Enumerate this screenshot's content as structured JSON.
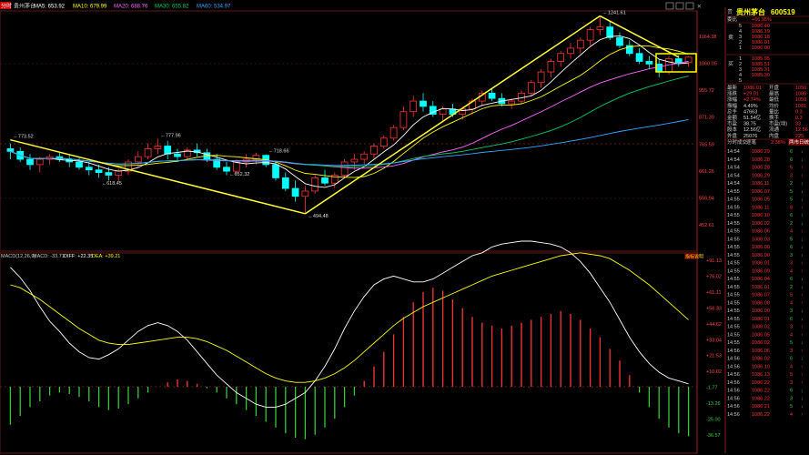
{
  "window": {
    "title_tag": "分时",
    "ma_legend": {
      "stock": "贵州茅台",
      "ma5": "MA5: 653.92",
      "ma10": "MA10: 679.99",
      "ma20": "MA20: 688.76",
      "ma30": "MA30: 655.82",
      "ma60": "MA60: 534.97"
    },
    "macd_legend": {
      "params": "MACD(12,26,9)",
      "macd": "MACD: -33.71",
      "diff": "DIFF: +22.35",
      "dea": "DEA: +39.21"
    },
    "indicator_button": "指标说明",
    "price_axis": [
      "1164.38",
      "1060.05",
      "955.72",
      "871.39",
      "765.59",
      "661.26",
      "556.94",
      "452.61"
    ],
    "macd_axis": [
      "+91.13",
      "+76.02",
      "+61.11",
      "+56.33",
      "+44.62",
      "+33.04",
      "+21.53",
      "+10.02",
      "-1.77",
      "-13.26",
      "-25.00",
      "-36.57"
    ],
    "macd_axis_colors": [
      "red",
      "red",
      "red",
      "red",
      "red",
      "red",
      "red",
      "red",
      "green",
      "green",
      "green",
      "green"
    ],
    "annotations": {
      "peak": "1241.61",
      "left_high": "773.52",
      "low1": "618.45",
      "mid_high": "777.96",
      "low2": "652.32",
      "mid_high2": "718.66",
      "bottom": "494.48"
    }
  },
  "quote_panel": {
    "header_glyph": "贵",
    "title": "贵州茅台",
    "code": "600519",
    "weibi_label": "委比",
    "weibi_value": "+66.95%",
    "sell_label": "卖",
    "buy_label": "买",
    "sell_orders": [
      {
        "n": "5",
        "price": "1086.40"
      },
      {
        "n": "4",
        "price": "1086.19"
      },
      {
        "n": "3",
        "price": "1086.18"
      },
      {
        "n": "2",
        "price": "1086.01"
      },
      {
        "n": "1",
        "price": "1086.00"
      }
    ],
    "buy_orders": [
      {
        "n": "1",
        "price": "1085.95"
      },
      {
        "n": "2",
        "price": "1085.51"
      },
      {
        "n": "3",
        "price": "1085.31"
      },
      {
        "n": "4",
        "price": "1085.30"
      },
      {
        "n": "5",
        "price": ""
      }
    ],
    "stats": [
      {
        "label": "最新",
        "value": "1086.01",
        "label2": "开盘",
        "value2": "1050"
      },
      {
        "label": "涨跌",
        "value": "+29.01",
        "label2": "最高",
        "value2": "1086"
      },
      {
        "label": "涨幅",
        "value": "+2.74%",
        "label2": "最低",
        "value2": "1050"
      },
      {
        "label": "振幅",
        "value": "4.49%",
        "label2": "均价",
        "value2": "1081"
      },
      {
        "label": "总手",
        "value": "47663",
        "label2": "量比",
        "value2": "0.3"
      },
      {
        "label": "金额",
        "value": "51.54亿",
        "label2": "换手",
        "value2": "0.3"
      },
      {
        "label": "市盈",
        "value": "38.75",
        "label2": "市盈(动)",
        "value2": "33"
      },
      {
        "label": "股本",
        "value": "12.56亿",
        "label2": "流通",
        "value2": "12.56"
      },
      {
        "label": "外盘",
        "value": "25076",
        "label2": "内盘",
        "value2": "225"
      }
    ],
    "trades_header": {
      "left": "分时成交",
      "right": "逐笔",
      "pct": "2.38%",
      "btn": "两市日统"
    },
    "trades": [
      {
        "t": "14:54",
        "p": "1086.29",
        "v": "6",
        "c": "green"
      },
      {
        "t": "14:54",
        "p": "1086.28",
        "v": "6",
        "c": "green"
      },
      {
        "t": "14:54",
        "p": "1086.28",
        "v": "5",
        "c": "red"
      },
      {
        "t": "14:54",
        "p": "1086.29",
        "v": "3",
        "c": "red"
      },
      {
        "t": "14:54",
        "p": "1086.11",
        "v": "2",
        "c": "green"
      },
      {
        "t": "14:55",
        "p": "1086.07",
        "v": "5",
        "c": "green"
      },
      {
        "t": "14:55",
        "p": "1086.05",
        "v": "5",
        "c": "green"
      },
      {
        "t": "14:55",
        "p": "1086.11",
        "v": "8",
        "c": "red"
      },
      {
        "t": "14:55",
        "p": "1086.10",
        "v": "6",
        "c": "green"
      },
      {
        "t": "14:55",
        "p": "1086.02",
        "v": "2",
        "c": "green"
      },
      {
        "t": "14:55",
        "p": "1086.06",
        "v": "4",
        "c": "red"
      },
      {
        "t": "14:55",
        "p": "1086.03",
        "v": "5",
        "c": "green"
      },
      {
        "t": "14:55",
        "p": "1086.00",
        "v": "6",
        "c": "green"
      },
      {
        "t": "14:55",
        "p": "1086.00",
        "v": "3",
        "c": "green"
      },
      {
        "t": "14:55",
        "p": "1086.01",
        "v": "3",
        "c": "red"
      },
      {
        "t": "14:55",
        "p": "1086.09",
        "v": "4",
        "c": "red"
      },
      {
        "t": "14:55",
        "p": "1086.04",
        "v": "6",
        "c": "green"
      },
      {
        "t": "14:55",
        "p": "1086.01",
        "v": "2",
        "c": "green"
      },
      {
        "t": "14:55",
        "p": "1086.07",
        "v": "5",
        "c": "red"
      },
      {
        "t": "14:55",
        "p": "1086.08",
        "v": "4",
        "c": "red"
      },
      {
        "t": "14:55",
        "p": "1086.00",
        "v": "3",
        "c": "green"
      },
      {
        "t": "14:55",
        "p": "1086.01",
        "v": "6",
        "c": "green"
      },
      {
        "t": "14:55",
        "p": "1086.02",
        "v": "3",
        "c": "red"
      },
      {
        "t": "14:55",
        "p": "1086.05",
        "v": "4",
        "c": "red"
      },
      {
        "t": "14:55",
        "p": "1086.02",
        "v": "5",
        "c": "green"
      },
      {
        "t": "14:56",
        "p": "1086.06",
        "v": "3",
        "c": "red"
      },
      {
        "t": "14:56",
        "p": "1086.02",
        "v": "6",
        "c": "green"
      },
      {
        "t": "14:56",
        "p": "1086.10",
        "v": "4",
        "c": "red"
      },
      {
        "t": "14:56",
        "p": "1086.13",
        "v": "5",
        "c": "red"
      },
      {
        "t": "14:56",
        "p": "1086.22",
        "v": "3",
        "c": "red"
      },
      {
        "t": "14:56",
        "p": "1086.22",
        "v": "6",
        "c": "green"
      },
      {
        "t": "14:56",
        "p": "1086.22",
        "v": "3",
        "c": "green"
      },
      {
        "t": "14:56",
        "p": "1086.21",
        "v": "5",
        "c": "green"
      },
      {
        "t": "14:56",
        "p": "1086.22",
        "v": "4",
        "c": "red"
      }
    ]
  },
  "chart_data": {
    "type": "candlestick",
    "ma_colors": {
      "ma5": "#ffffff",
      "ma10": "#ffff00",
      "ma20": "#ff66ff",
      "ma30": "#00cc66",
      "ma60": "#33aaff"
    },
    "up_color": "#ff3333",
    "down_color": "#00ffff",
    "ylim": [
      452.61,
      1164.38
    ],
    "candles": [
      [
        740,
        760,
        700,
        730
      ],
      [
        730,
        745,
        690,
        700
      ],
      [
        700,
        720,
        660,
        680
      ],
      [
        680,
        710,
        650,
        700
      ],
      [
        700,
        720,
        680,
        710
      ],
      [
        710,
        725,
        690,
        700
      ],
      [
        700,
        715,
        670,
        690
      ],
      [
        690,
        705,
        660,
        670
      ],
      [
        670,
        690,
        640,
        660
      ],
      [
        660,
        680,
        630,
        650
      ],
      [
        650,
        670,
        620,
        640
      ],
      [
        640,
        665,
        615,
        655
      ],
      [
        655,
        700,
        640,
        690
      ],
      [
        690,
        730,
        670,
        710
      ],
      [
        710,
        760,
        700,
        740
      ],
      [
        740,
        778,
        720,
        750
      ],
      [
        750,
        770,
        700,
        720
      ],
      [
        720,
        740,
        690,
        710
      ],
      [
        710,
        745,
        695,
        735
      ],
      [
        735,
        760,
        710,
        725
      ],
      [
        725,
        740,
        690,
        700
      ],
      [
        700,
        720,
        660,
        670
      ],
      [
        670,
        690,
        640,
        655
      ],
      [
        655,
        700,
        645,
        690
      ],
      [
        690,
        720,
        670,
        700
      ],
      [
        700,
        725,
        680,
        715
      ],
      [
        715,
        719,
        670,
        680
      ],
      [
        680,
        690,
        620,
        630
      ],
      [
        630,
        650,
        580,
        590
      ],
      [
        590,
        620,
        540,
        560
      ],
      [
        560,
        600,
        495,
        580
      ],
      [
        580,
        640,
        570,
        630
      ],
      [
        630,
        660,
        600,
        610
      ],
      [
        610,
        650,
        590,
        640
      ],
      [
        640,
        700,
        630,
        690
      ],
      [
        690,
        720,
        660,
        700
      ],
      [
        700,
        730,
        680,
        720
      ],
      [
        720,
        760,
        700,
        750
      ],
      [
        750,
        790,
        740,
        780
      ],
      [
        780,
        830,
        770,
        820
      ],
      [
        820,
        900,
        810,
        880
      ],
      [
        880,
        940,
        860,
        920
      ],
      [
        920,
        950,
        880,
        900
      ],
      [
        900,
        920,
        860,
        870
      ],
      [
        870,
        900,
        840,
        890
      ],
      [
        890,
        910,
        860,
        870
      ],
      [
        870,
        900,
        850,
        890
      ],
      [
        890,
        930,
        870,
        920
      ],
      [
        920,
        960,
        900,
        950
      ],
      [
        950,
        970,
        920,
        930
      ],
      [
        930,
        950,
        900,
        910
      ],
      [
        910,
        930,
        890,
        920
      ],
      [
        920,
        960,
        910,
        950
      ],
      [
        950,
        1000,
        940,
        990
      ],
      [
        990,
        1040,
        970,
        1030
      ],
      [
        1030,
        1080,
        1010,
        1070
      ],
      [
        1070,
        1110,
        1050,
        1100
      ],
      [
        1100,
        1140,
        1080,
        1120
      ],
      [
        1120,
        1160,
        1100,
        1150
      ],
      [
        1150,
        1200,
        1130,
        1190
      ],
      [
        1190,
        1242,
        1170,
        1200
      ],
      [
        1200,
        1220,
        1150,
        1160
      ],
      [
        1160,
        1180,
        1120,
        1130
      ],
      [
        1130,
        1150,
        1090,
        1100
      ],
      [
        1100,
        1120,
        1060,
        1070
      ],
      [
        1070,
        1090,
        1040,
        1060
      ],
      [
        1060,
        1080,
        1010,
        1030
      ],
      [
        1030,
        1090,
        1020,
        1080
      ],
      [
        1080,
        1095,
        1050,
        1065
      ],
      [
        1065,
        1090,
        1050,
        1086
      ]
    ],
    "macd": [
      -26,
      -20,
      -14,
      -10,
      -6,
      -4,
      -5,
      -7,
      -10,
      -14,
      -16,
      -15,
      -12,
      -8,
      -4,
      0,
      3,
      5,
      4,
      2,
      -1,
      -4,
      -8,
      -12,
      -16,
      -20,
      -24,
      -28,
      -32,
      -35,
      -36,
      -33,
      -28,
      -22,
      -14,
      -6,
      4,
      14,
      24,
      36,
      48,
      58,
      65,
      68,
      66,
      60,
      54,
      48,
      44,
      42,
      40,
      42,
      44,
      46,
      48,
      50,
      52,
      50,
      46,
      40,
      34,
      26,
      18,
      8,
      -4,
      -14,
      -22,
      -28,
      -32,
      -34
    ],
    "diff": [
      82,
      75,
      66,
      55,
      45,
      38,
      30,
      24,
      20,
      19,
      22,
      26,
      32,
      38,
      42,
      44,
      42,
      38,
      32,
      24,
      16,
      8,
      2,
      -4,
      -8,
      -12,
      -14,
      -14,
      -12,
      -8,
      -4,
      4,
      14,
      26,
      40,
      52,
      62,
      70,
      74,
      76,
      74,
      72,
      72,
      74,
      78,
      82,
      86,
      90,
      92,
      96,
      98,
      99,
      100,
      100,
      99,
      98,
      96,
      92,
      86,
      78,
      68,
      58,
      46,
      34,
      24,
      16,
      10,
      6,
      4,
      2
    ],
    "dea": [
      70,
      68,
      64,
      60,
      55,
      50,
      45,
      40,
      36,
      32,
      30,
      29,
      29,
      30,
      31,
      32,
      33,
      34,
      34,
      33,
      31,
      28,
      25,
      21,
      17,
      13,
      9,
      6,
      4,
      3,
      3,
      4,
      6,
      9,
      13,
      18,
      24,
      30,
      36,
      42,
      47,
      51,
      55,
      58,
      61,
      64,
      67,
      70,
      73,
      76,
      78,
      80,
      82,
      84,
      86,
      88,
      90,
      91,
      92,
      91,
      90,
      88,
      84,
      80,
      75,
      70,
      64,
      58,
      52,
      46
    ]
  }
}
